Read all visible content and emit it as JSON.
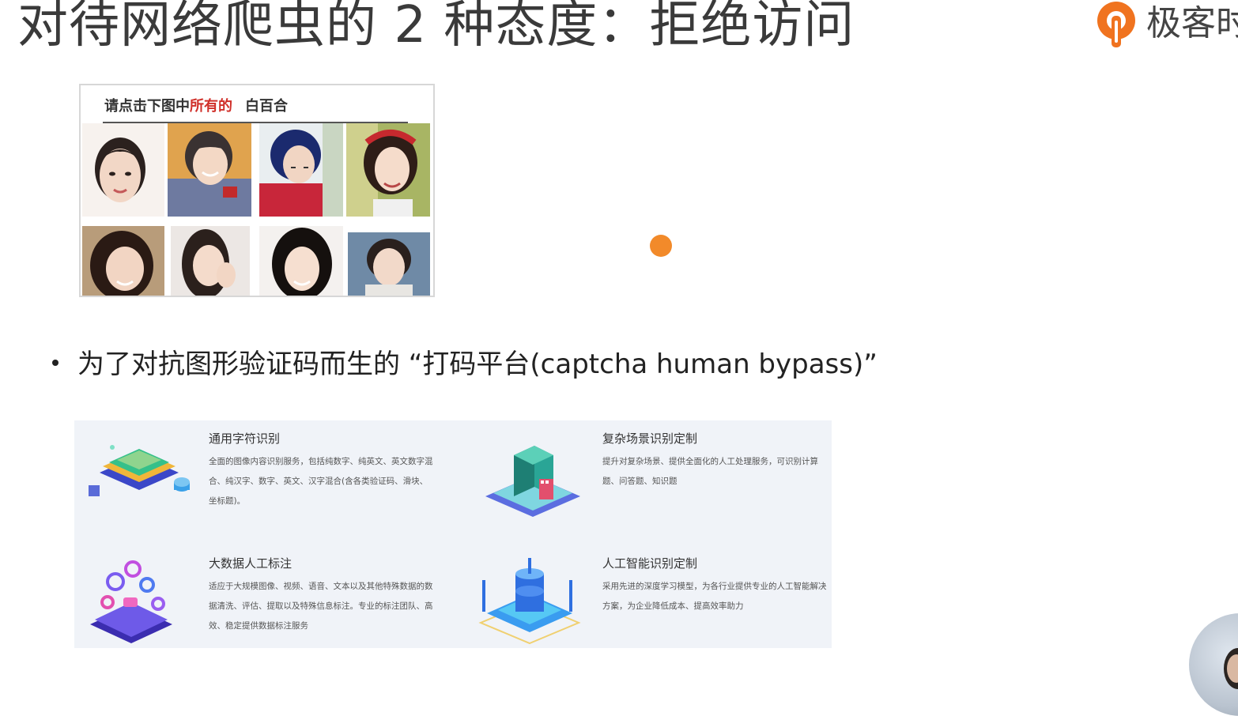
{
  "slide": {
    "title": "对待网络爬虫的 2 种态度：拒绝访问",
    "brand_name": "极客时间"
  },
  "captcha": {
    "prompt_prefix": "请点击下图中",
    "prompt_highlight": "所有的",
    "prompt_target": "白百合"
  },
  "bullet": {
    "text": "为了对抗图形验证码而生的 “打码平台(captcha human bypass)”"
  },
  "services": [
    {
      "title": "通用字符识别",
      "desc": "全面的图像内容识别服务，包括纯数字、纯英文、英文数字混合、纯汉字、数字、英文、汉字混合(含各类验证码、滑块、坐标题)。",
      "icon": "layers-chip-icon"
    },
    {
      "title": "复杂场景识别定制",
      "desc": "提升对复杂场景、提供全面化的人工处理服务，可识别计算题、问答题、知识题",
      "icon": "city-building-icon"
    },
    {
      "title": "大数据人工标注",
      "desc": "适应于大规模图像、视频、语音、文本以及其他特殊数据的数据清洗、评估、提取以及特殊信息标注。专业的标注团队、高效、稳定提供数据标注服务",
      "icon": "data-nodes-icon"
    },
    {
      "title": "人工智能识别定制",
      "desc": "采用先进的深度学习模型，为各行业提供专业的人工智能解决方案，为企业降低成本、提高效率助力",
      "icon": "ai-cube-icon"
    }
  ],
  "colors": {
    "accent": "#f28a2a",
    "highlight": "#d0302a",
    "panel": "#f0f3f8"
  }
}
